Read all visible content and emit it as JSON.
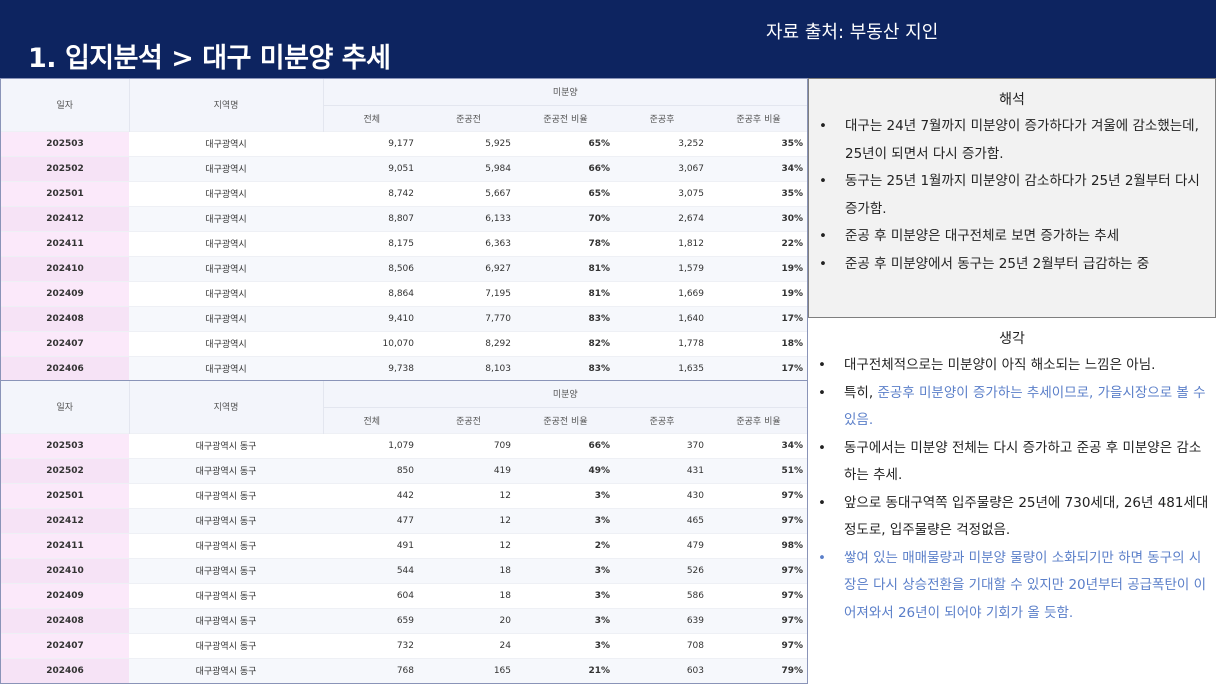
{
  "header": {
    "title": "1. 입지분석 > 대구 미분양 추세",
    "source": "자료 출처: 부동산 지인"
  },
  "colors": {
    "header_bg": "#0d2460",
    "date_cell_bg": "#fbe9fa",
    "highlight_text": "#5b7fc9"
  },
  "table_headers": {
    "date": "일자",
    "region": "지역명",
    "group": "미분양",
    "total": "전체",
    "before": "준공전",
    "before_ratio": "준공전 비율",
    "after": "준공후",
    "after_ratio": "준공후 비율"
  },
  "table1": {
    "rows": [
      [
        "202503",
        "대구광역시",
        "9,177",
        "5,925",
        "65%",
        "3,252",
        "35%"
      ],
      [
        "202502",
        "대구광역시",
        "9,051",
        "5,984",
        "66%",
        "3,067",
        "34%"
      ],
      [
        "202501",
        "대구광역시",
        "8,742",
        "5,667",
        "65%",
        "3,075",
        "35%"
      ],
      [
        "202412",
        "대구광역시",
        "8,807",
        "6,133",
        "70%",
        "2,674",
        "30%"
      ],
      [
        "202411",
        "대구광역시",
        "8,175",
        "6,363",
        "78%",
        "1,812",
        "22%"
      ],
      [
        "202410",
        "대구광역시",
        "8,506",
        "6,927",
        "81%",
        "1,579",
        "19%"
      ],
      [
        "202409",
        "대구광역시",
        "8,864",
        "7,195",
        "81%",
        "1,669",
        "19%"
      ],
      [
        "202408",
        "대구광역시",
        "9,410",
        "7,770",
        "83%",
        "1,640",
        "17%"
      ],
      [
        "202407",
        "대구광역시",
        "10,070",
        "8,292",
        "82%",
        "1,778",
        "18%"
      ],
      [
        "202406",
        "대구광역시",
        "9,738",
        "8,103",
        "83%",
        "1,635",
        "17%"
      ]
    ]
  },
  "table2": {
    "rows": [
      [
        "202503",
        "대구광역시 동구",
        "1,079",
        "709",
        "66%",
        "370",
        "34%"
      ],
      [
        "202502",
        "대구광역시 동구",
        "850",
        "419",
        "49%",
        "431",
        "51%"
      ],
      [
        "202501",
        "대구광역시 동구",
        "442",
        "12",
        "3%",
        "430",
        "97%"
      ],
      [
        "202412",
        "대구광역시 동구",
        "477",
        "12",
        "3%",
        "465",
        "97%"
      ],
      [
        "202411",
        "대구광역시 동구",
        "491",
        "12",
        "2%",
        "479",
        "98%"
      ],
      [
        "202410",
        "대구광역시 동구",
        "544",
        "18",
        "3%",
        "526",
        "97%"
      ],
      [
        "202409",
        "대구광역시 동구",
        "604",
        "18",
        "3%",
        "586",
        "97%"
      ],
      [
        "202408",
        "대구광역시 동구",
        "659",
        "20",
        "3%",
        "639",
        "97%"
      ],
      [
        "202407",
        "대구광역시 동구",
        "732",
        "24",
        "3%",
        "708",
        "97%"
      ],
      [
        "202406",
        "대구광역시 동구",
        "768",
        "165",
        "21%",
        "603",
        "79%"
      ]
    ]
  },
  "interpretation": {
    "title": "해석",
    "items": [
      "대구는 24년 7월까지 미분양이 증가하다가 겨울에 감소했는데, 25년이 되면서 다시 증가함.",
      "동구는 25년 1월까지 미분양이 감소하다가 25년 2월부터 다시 증가함.",
      "준공 후 미분양은 대구전체로 보면 증가하는 추세",
      "준공 후 미분양에서 동구는 25년 2월부터 급감하는 중"
    ]
  },
  "thoughts": {
    "title": "생각",
    "item1": "대구전체적으로는 미분양이 아직 해소되는 느낌은 아님.",
    "item2_prefix": "특히, ",
    "item2_highlight": "준공후 미분양이 증가하는 추세이므로, 가을시장으로 볼 수 있음.",
    "item3": "동구에서는 미분양 전체는 다시 증가하고 준공 후 미분양은 감소하는 추세.",
    "item4": "앞으로 동대구역쪽 입주물량은 25년에 730세대, 26년 481세대 정도로, 입주물량은 걱정없음.",
    "item5": "쌓여 있는 매매물량과 미분양 물량이 소화되기만 하면 동구의 시장은 다시 상승전환을 기대할 수 있지만 20년부터 공급폭탄이 이어져와서 26년이 되어야 기회가 올 듯함."
  }
}
